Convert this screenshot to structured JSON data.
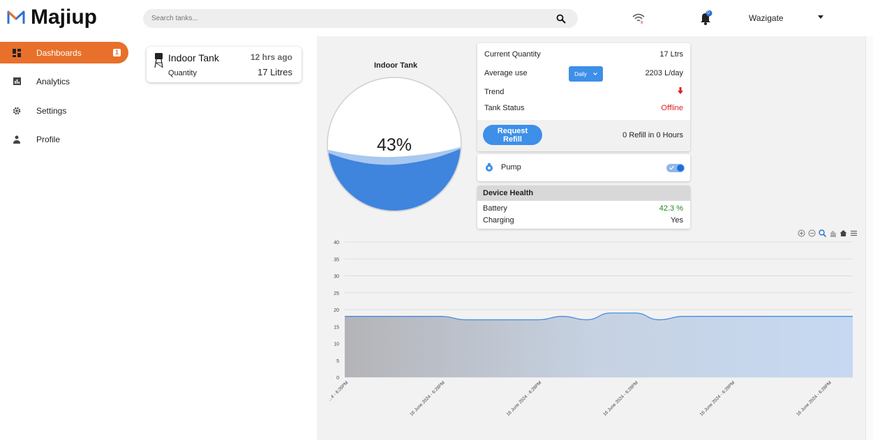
{
  "app": {
    "name": "Majiup",
    "search_placeholder": "Search tanks...",
    "notification_count": "0",
    "user": "Wazigate"
  },
  "sidebar": {
    "items": [
      {
        "label": "Dashboards",
        "icon": "dashboard-icon",
        "badge": "1",
        "active": true
      },
      {
        "label": "Analytics",
        "icon": "analytics-icon"
      },
      {
        "label": "Settings",
        "icon": "gear-icon"
      },
      {
        "label": "Profile",
        "icon": "person-icon"
      }
    ]
  },
  "tank_list": [
    {
      "name": "Indoor Tank",
      "time": "12 hrs ago",
      "quantity_label": "Quantity",
      "quantity": "17 Litres"
    }
  ],
  "gauge": {
    "title": "Indoor Tank",
    "percent_label": "43%",
    "fill_level": 0.43,
    "water_color": "#3f84dd"
  },
  "info": {
    "current_quantity_label": "Current Quantity",
    "current_quantity": "17 Ltrs",
    "average_use_label": "Average use",
    "period_option": "Daily",
    "average_use": "2203 L/day",
    "trend_label": "Trend",
    "trend_icon": "arrow-down-icon",
    "status_label": "Tank Status",
    "status": "Offline",
    "status_color": "#e02020",
    "refill_button": "Request Refill",
    "refill_text": "0  Refill in 0 Hours"
  },
  "pump": {
    "label": "Pump",
    "on": true
  },
  "health": {
    "title": "Device Health",
    "battery_label": "Battery",
    "battery": "42.3 %",
    "battery_color": "#1a8a1a",
    "charging_label": "Charging",
    "charging": "Yes"
  },
  "chart_tools": [
    "zoom-in-icon",
    "zoom-out-icon",
    "zoom-select-icon",
    "pan-icon",
    "home-icon",
    "menu-icon"
  ],
  "chart_data": {
    "type": "area",
    "ylim": [
      0,
      40
    ],
    "yticks": [
      "0",
      "5",
      "10",
      "15",
      "20",
      "25",
      "30",
      "35",
      "40"
    ],
    "x_labels": [
      "...4 - 6:26PM",
      "16 June 2024 - 6:28PM",
      "16 June 2024 - 6:28PM",
      "16 June 2024 - 6:28PM",
      "16 June 2024 - 6:28PM",
      "16 June 2024 - 6:28PM"
    ],
    "series": [
      {
        "values": [
          18,
          18,
          18,
          18,
          18,
          17,
          17,
          17,
          17,
          18,
          17,
          19,
          19,
          17,
          18,
          18,
          18,
          18,
          18,
          18,
          18,
          18
        ]
      }
    ],
    "line_color": "#4a8ee0",
    "fill_color": "#c6d9f2"
  }
}
